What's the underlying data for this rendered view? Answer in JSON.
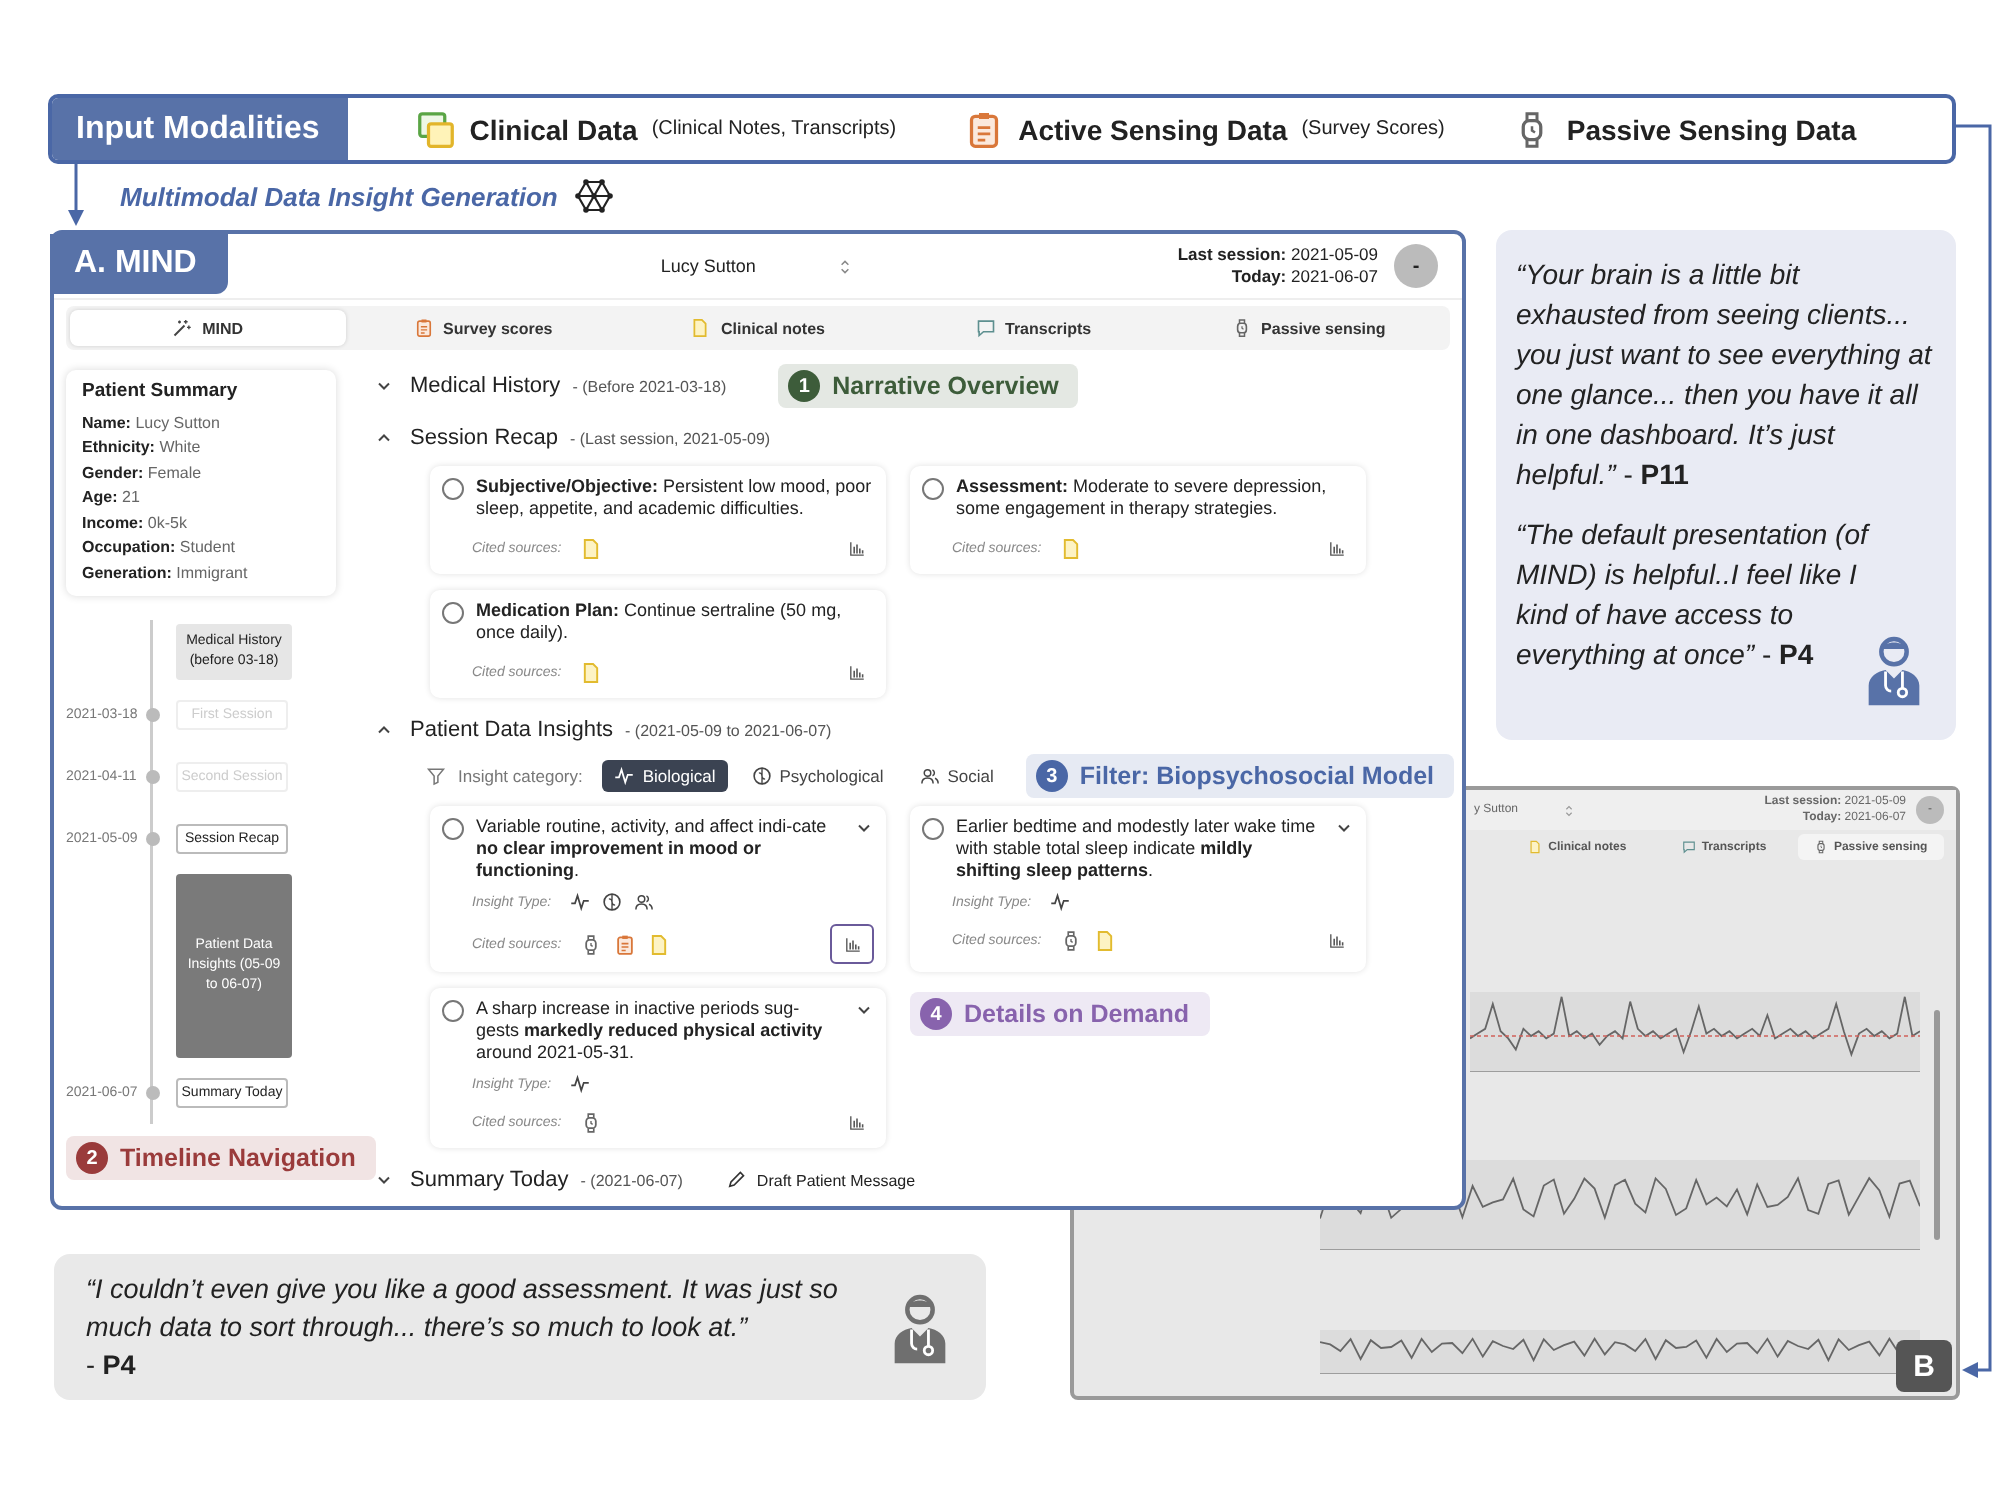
{
  "input_modalities": {
    "title": "Input Modalities",
    "items": [
      {
        "kind": "clinical",
        "label": "Clinical Data",
        "detail": "(Clinical Notes, Transcripts)"
      },
      {
        "kind": "active",
        "label": "Active Sensing Data",
        "detail": "(Survey Scores)"
      },
      {
        "kind": "passive",
        "label": "Passive Sensing Data"
      }
    ]
  },
  "generation_label": "Multimodal Data Insight Generation",
  "mind_window": {
    "badge": "A. MIND",
    "patient_select": "Lucy Sutton",
    "last_session_label": "Last session:",
    "last_session": "2021-05-09",
    "today_label": "Today:",
    "today": "2021-06-07",
    "avatar": "-",
    "tabs": [
      {
        "kind": "mind",
        "label": "MIND",
        "selected": true
      },
      {
        "kind": "survey",
        "label": "Survey scores",
        "selected": false
      },
      {
        "kind": "clinical",
        "label": "Clinical notes",
        "selected": false
      },
      {
        "kind": "transcripts",
        "label": "Transcripts",
        "selected": false
      },
      {
        "kind": "passive",
        "label": "Passive sensing",
        "selected": false
      }
    ],
    "patient_summary": {
      "title": "Patient Summary",
      "fields": [
        {
          "label": "Name:",
          "value": "Lucy Sutton"
        },
        {
          "label": "Ethnicity:",
          "value": "White"
        },
        {
          "label": "Gender:",
          "value": "Female"
        },
        {
          "label": "Age:",
          "value": "21"
        },
        {
          "label": "Income:",
          "value": "0k-5k"
        },
        {
          "label": "Occupation:",
          "value": "Student"
        },
        {
          "label": "Generation:",
          "value": "Immigrant"
        }
      ]
    },
    "timeline": [
      {
        "kind": "period",
        "label": "Medical History (before 03-18)",
        "selected": false,
        "disabled": false
      },
      {
        "kind": "session",
        "date": "2021-03-18",
        "label": "First Session",
        "selected": false,
        "disabled": true
      },
      {
        "kind": "session",
        "date": "2021-04-11",
        "label": "Second Session",
        "selected": false,
        "disabled": true
      },
      {
        "kind": "session",
        "date": "2021-05-09",
        "label": "Session Recap",
        "selected": false,
        "disabled": false
      },
      {
        "kind": "period",
        "label": "Patient Data Insights (05-09 to 06-07)",
        "selected": true,
        "disabled": false
      },
      {
        "kind": "session",
        "date": "2021-06-07",
        "label": "Summary Today",
        "selected": false,
        "disabled": false
      }
    ],
    "sections": [
      {
        "title": "Medical History",
        "subtitle": "- (Before 2021-03-18)",
        "expanded": false
      },
      {
        "title": "Session Recap",
        "subtitle": "- (Last session, 2021-05-09)",
        "expanded": true,
        "cards": [
          {
            "text": "**Subjective/Objective:** Persistent low mood, poor sleep, appetite, and academic difficulties.",
            "checked": false,
            "cited_label": "Cited sources:",
            "sources": [
              {
                "kind": "note"
              }
            ],
            "chart_selected": false
          },
          {
            "text": "**Assessment:** Moderate to severe depression, some engagement in therapy strategies.",
            "checked": false,
            "cited_label": "Cited sources:",
            "sources": [
              {
                "kind": "note"
              }
            ],
            "chart_selected": false
          },
          {
            "text": "**Medication Plan:** Continue sertraline (50 mg, once daily).",
            "checked": false,
            "cited_label": "Cited sources:",
            "sources": [
              {
                "kind": "note"
              }
            ],
            "chart_selected": false
          }
        ]
      },
      {
        "title": "Patient Data Insights",
        "subtitle": "- (2021-05-09 to 2021-06-07)",
        "expanded": true,
        "filter": {
          "label": "Insight category:",
          "options": [
            {
              "kind": "biological",
              "label": "Biological",
              "selected": true
            },
            {
              "kind": "psychological",
              "label": "Psychological",
              "selected": false
            },
            {
              "kind": "social",
              "label": "Social",
              "selected": false
            }
          ]
        },
        "cards": [
          {
            "text": "Variable routine, activity, and affect indi-cate **no clear improvement in mood or functioning**.",
            "checked": false,
            "expandable": true,
            "insight_label": "Insight Type:",
            "insight_types": [
              {
                "kind": "biological"
              },
              {
                "kind": "psychological"
              },
              {
                "kind": "social"
              }
            ],
            "cited_label": "Cited sources:",
            "sources": [
              {
                "kind": "watch"
              },
              {
                "kind": "clipboard"
              },
              {
                "kind": "note"
              }
            ],
            "chart_selected": true
          },
          {
            "text": "Earlier bedtime and modestly later wake time with stable total sleep indicate **mildly shifting sleep patterns**.",
            "checked": false,
            "expandable": true,
            "insight_label": "Insight Type:",
            "insight_types": [
              {
                "kind": "biological"
              }
            ],
            "cited_label": "Cited sources:",
            "sources": [
              {
                "kind": "watch"
              },
              {
                "kind": "note"
              }
            ],
            "chart_selected": false
          },
          {
            "text": "A sharp increase in inactive periods sug-gests **markedly reduced physical activity** around 2021-05-31.",
            "checked": false,
            "expandable": true,
            "insight_label": "Insight Type:",
            "insight_types": [
              {
                "kind": "biological"
              }
            ],
            "cited_label": "Cited sources:",
            "sources": [
              {
                "kind": "watch"
              }
            ],
            "chart_selected": false
          }
        ]
      },
      {
        "title": "Summary Today",
        "subtitle": "- (2021-06-07)",
        "expanded": false,
        "action": "Draft Patient Message"
      }
    ],
    "annotations": [
      {
        "kind": "overview",
        "number": "1",
        "label": "Narrative Overview",
        "color": "#3d5c3a"
      },
      {
        "kind": "timeline",
        "number": "2",
        "label": "Timeline Navigation",
        "color": "#9a3b3b"
      },
      {
        "kind": "filter",
        "number": "3",
        "label": "Filter: Biopsychosocial Model",
        "color": "#4a67a6"
      },
      {
        "kind": "details",
        "number": "4",
        "label": "Details on Demand",
        "color": "#8863ad"
      }
    ]
  },
  "screenshot_b": {
    "label": "B",
    "patient_select": "y Sutton",
    "last_session_label": "Last session:",
    "last_session": "2021-05-09",
    "today_label": "Today:",
    "today": "2021-06-07",
    "avatar": "-",
    "tabs": [
      {
        "kind": "clinical",
        "label": "Clinical notes",
        "selected": false
      },
      {
        "kind": "transcripts",
        "label": "Transcripts",
        "selected": false
      },
      {
        "kind": "passive",
        "label": "Passive sensing",
        "selected": true
      }
    ]
  },
  "quote_panels": [
    {
      "kind": "praise",
      "quotes": [
        "*“Your brain is a little bit exhausted from seeing clients... you just want to see everything at one glance... then you have it all in one dashboard. It’s just helpful.”* - **P11**",
        "*“The default presentation (of MIND) is helpful..I feel like I kind of have access to everything at once”* - **P4**"
      ]
    },
    {
      "kind": "critique",
      "quotes": [
        "*“I couldn’t even give you like a good assessment. It was just so much data to sort through... there’s so much to look at.”*\n- **P4**"
      ]
    }
  ]
}
